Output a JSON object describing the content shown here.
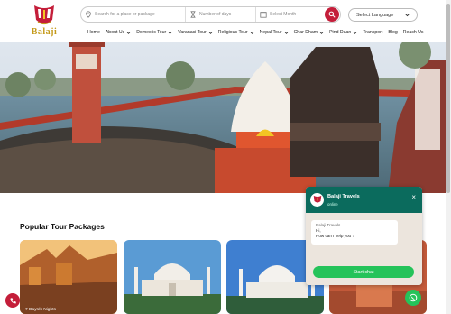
{
  "brand": {
    "name": "Balaji",
    "primary": "#c41e3a",
    "gold": "#c49a1a"
  },
  "search": {
    "place_placeholder": "Search for a place or package",
    "days_placeholder": "Number of days",
    "month_placeholder": "Select Month",
    "go_icon": "search-icon"
  },
  "language": {
    "selected": "Select Language"
  },
  "nav": {
    "items": [
      {
        "label": "Home",
        "dropdown": false
      },
      {
        "label": "About Us",
        "dropdown": true
      },
      {
        "label": "Domestic Tour",
        "dropdown": true
      },
      {
        "label": "Varanasi Tour",
        "dropdown": true
      },
      {
        "label": "Religious Tour",
        "dropdown": true
      },
      {
        "label": "Nepal Tour",
        "dropdown": true
      },
      {
        "label": "Char Dham",
        "dropdown": true
      },
      {
        "label": "Pind Daan",
        "dropdown": true
      },
      {
        "label": "Transport",
        "dropdown": false
      },
      {
        "label": "Blog",
        "dropdown": false
      },
      {
        "label": "Reach Us",
        "dropdown": false
      }
    ]
  },
  "section": {
    "title": "Popular Tour Packages"
  },
  "cards": [
    {
      "caption": "7 Days/6 Nights"
    },
    {
      "caption": ""
    },
    {
      "caption": ""
    },
    {
      "caption": ""
    }
  ],
  "chat": {
    "name": "Balaji Travels",
    "status": "online",
    "sender": "Balaji Travels",
    "line1": "Hi,",
    "line2": "How can I help you ?",
    "cta": "Start chat",
    "header_color": "#0b6b5d",
    "cta_color": "#25c35a"
  }
}
